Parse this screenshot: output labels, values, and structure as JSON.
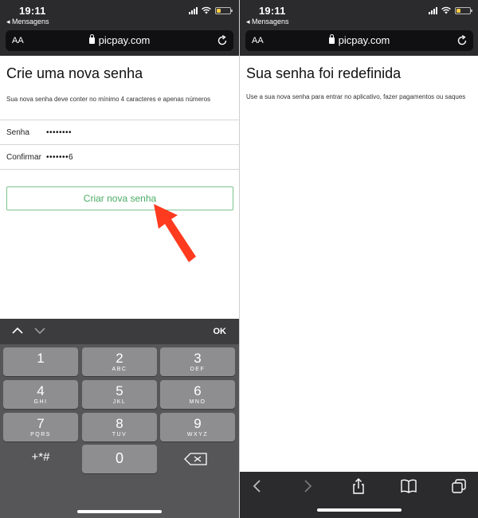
{
  "left": {
    "status": {
      "time": "19:11",
      "back": "◂ Mensagens"
    },
    "browser": {
      "aa": "AA",
      "url": "picpay.com"
    },
    "page": {
      "title": "Crie uma nova senha",
      "subtitle": "Sua nova senha deve conter no mínimo 4 caracteres e apenas números",
      "fields": [
        {
          "label": "Senha",
          "value": "••••••••"
        },
        {
          "label": "Confirmar",
          "value": "•••••••6"
        }
      ],
      "button": "Criar nova senha"
    },
    "keyboard": {
      "ok": "OK",
      "keys": [
        {
          "digit": "1",
          "letters": ""
        },
        {
          "digit": "2",
          "letters": "ABC"
        },
        {
          "digit": "3",
          "letters": "DEF"
        },
        {
          "digit": "4",
          "letters": "GHI"
        },
        {
          "digit": "5",
          "letters": "JKL"
        },
        {
          "digit": "6",
          "letters": "MNO"
        },
        {
          "digit": "7",
          "letters": "PQRS"
        },
        {
          "digit": "8",
          "letters": "TUV"
        },
        {
          "digit": "9",
          "letters": "WXYZ"
        }
      ],
      "symbols": "+*#",
      "zero": "0"
    }
  },
  "right": {
    "status": {
      "time": "19:11",
      "back": "◂ Mensagens"
    },
    "browser": {
      "aa": "AA",
      "url": "picpay.com"
    },
    "page": {
      "title": "Sua senha foi redefinida",
      "subtitle": "Use a sua nova senha para entrar no aplicativo, fazer pagamentos ou saques"
    }
  },
  "colors": {
    "chrome": "#2b2b2d",
    "button_border": "#7dc38d",
    "button_text": "#4aab63",
    "arrow": "#ff3b1f",
    "battery": "#f2c94c"
  }
}
